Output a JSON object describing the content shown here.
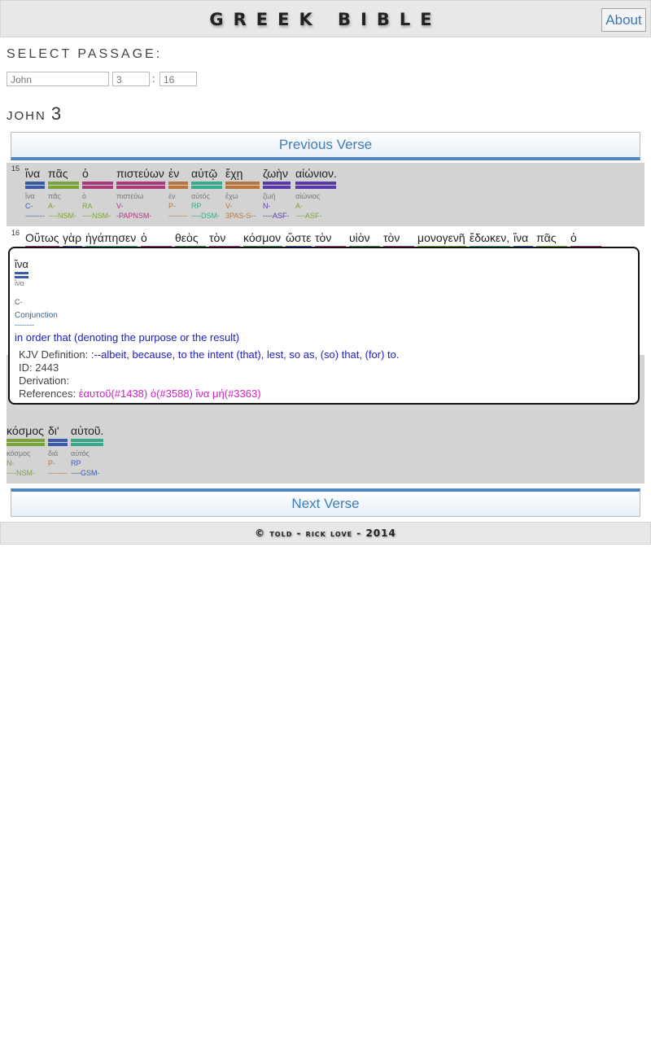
{
  "site": {
    "title": "GREEK BIBLE",
    "about_label": "About"
  },
  "select": {
    "label": "SELECT PASSAGE:",
    "book": "John",
    "chapter": "3",
    "separator": ":",
    "verse": "16"
  },
  "heading": {
    "book": "JOHN",
    "chapter": "3"
  },
  "nav": {
    "prev": "Previous Verse",
    "next": "Next Verse"
  },
  "colors": {
    "conj": "#3a5ba8",
    "adj": "#7aa33a",
    "art": "#a8397a",
    "verb": "#a8397a",
    "prep": "#b8743a",
    "pron": "#3aa88a",
    "noun": "#5a3aa8",
    "part": "#3a8a5a"
  },
  "verse15": {
    "num": "15",
    "words": [
      {
        "gk": "ἵνα",
        "lemma": "ἵνα",
        "pos": "C-",
        "parse": "--------",
        "color": "#3a5ba8",
        "poscolor": "#3a5ba8"
      },
      {
        "gk": "πᾶς",
        "lemma": "πᾶς",
        "pos": "A-",
        "parse": "----NSM-",
        "color": "#7aa33a",
        "poscolor": "#7aa33a"
      },
      {
        "gk": "ὁ",
        "lemma": "ὁ",
        "pos": "RA",
        "parse": "----NSM-",
        "color": "#a8397a",
        "poscolor": "#7aa33a"
      },
      {
        "gk": "πιστεύων",
        "lemma": "πιστεύω",
        "pos": "V-",
        "parse": "-PAPNSM-",
        "color": "#a8397a",
        "poscolor": "#a8397a"
      },
      {
        "gk": "ἐν",
        "lemma": "ἐν",
        "pos": "P-",
        "parse": "--------",
        "color": "#b8743a",
        "poscolor": "#b8743a"
      },
      {
        "gk": "αὐτῷ",
        "lemma": "αὐτός",
        "pos": "RP",
        "parse": "----DSM-",
        "color": "#3aa88a",
        "poscolor": "#3aa88a"
      },
      {
        "gk": "ἔχῃ",
        "lemma": "ἔχω",
        "pos": "V-",
        "parse": "3PAS-S--",
        "color": "#b8743a",
        "poscolor": "#b8743a"
      },
      {
        "gk": "ζωὴν",
        "lemma": "ζωή",
        "pos": "N-",
        "parse": "----ASF-",
        "color": "#5a3aa8",
        "poscolor": "#5a3aa8"
      },
      {
        "gk": "αἰώνιον.",
        "lemma": "αἰώνιος",
        "pos": "A-",
        "parse": "----ASF-",
        "color": "#5a3aa8",
        "poscolor": "#7aa33a"
      }
    ]
  },
  "verse16": {
    "num": "16",
    "words": [
      {
        "gk": "Οὕτως",
        "color": "#a8397a"
      },
      {
        "gk": "γὰρ",
        "color": "#3a5ba8"
      },
      {
        "gk": "ἠγάπησεν",
        "color": "#3aa88a"
      },
      {
        "gk": "ὁ",
        "color": "#a8397a"
      },
      {
        "gk": "θεὸς",
        "color": "#3a8a5a"
      },
      {
        "gk": "τὸν",
        "color": "#a8397a"
      },
      {
        "gk": "κόσμον",
        "color": "#3a8a5a"
      },
      {
        "gk": "ὥστε",
        "color": "#3a5ba8"
      },
      {
        "gk": "τὸν",
        "color": "#a8397a"
      },
      {
        "gk": "υἱὸν",
        "color": "#3a8a5a"
      },
      {
        "gk": "τὸν",
        "color": "#a8397a"
      },
      {
        "gk": "μονογενῆ",
        "color": "#7aa33a"
      },
      {
        "gk": "ἔδωκεν,",
        "color": "#3aa88a"
      },
      {
        "gk": "ἵνα",
        "color": "#3a5ba8"
      },
      {
        "gk": "πᾶς",
        "color": "#7aa33a"
      },
      {
        "gk": "ὁ",
        "color": "#a8397a"
      }
    ],
    "tail": [
      {
        "gk": "κόσμος",
        "lemma": "κόσμος",
        "pos": "N-",
        "parse": "----NSM-",
        "color": "#7aa33a",
        "poscolor": "#7aa33a"
      },
      {
        "gk": "δι'",
        "lemma": "διά",
        "pos": "P-",
        "parse": "--------",
        "color": "#3a5ba8",
        "poscolor": "#b8743a"
      },
      {
        "gk": "αὐτοῦ.",
        "lemma": "αὐτός",
        "pos": "RP",
        "parse": "----GSM-",
        "color": "#3aa88a",
        "poscolor": "#3a5ba8"
      }
    ]
  },
  "popup": {
    "word": "ἵνα",
    "lemma": "ἵνα",
    "pos_code": "C-",
    "pos_name": "Conjunction",
    "parse": "--------",
    "gloss": "in order that (denoting the purpose or the result)",
    "kjv_label": "KJV Definition:",
    "kjv_value": ":--albeit, because, to the intent (that), lest, so as, (so) that, (for) to.",
    "id_label": "ID:",
    "id_value": "2443",
    "derivation_label": "Derivation:",
    "derivation_value": "",
    "references_label": "References:",
    "references_value": "ἑαυτοῦ(#1438) ὁ(#3588) ἵνα μή(#3363)"
  },
  "footer": {
    "text": "© told - rick love - 2014"
  }
}
